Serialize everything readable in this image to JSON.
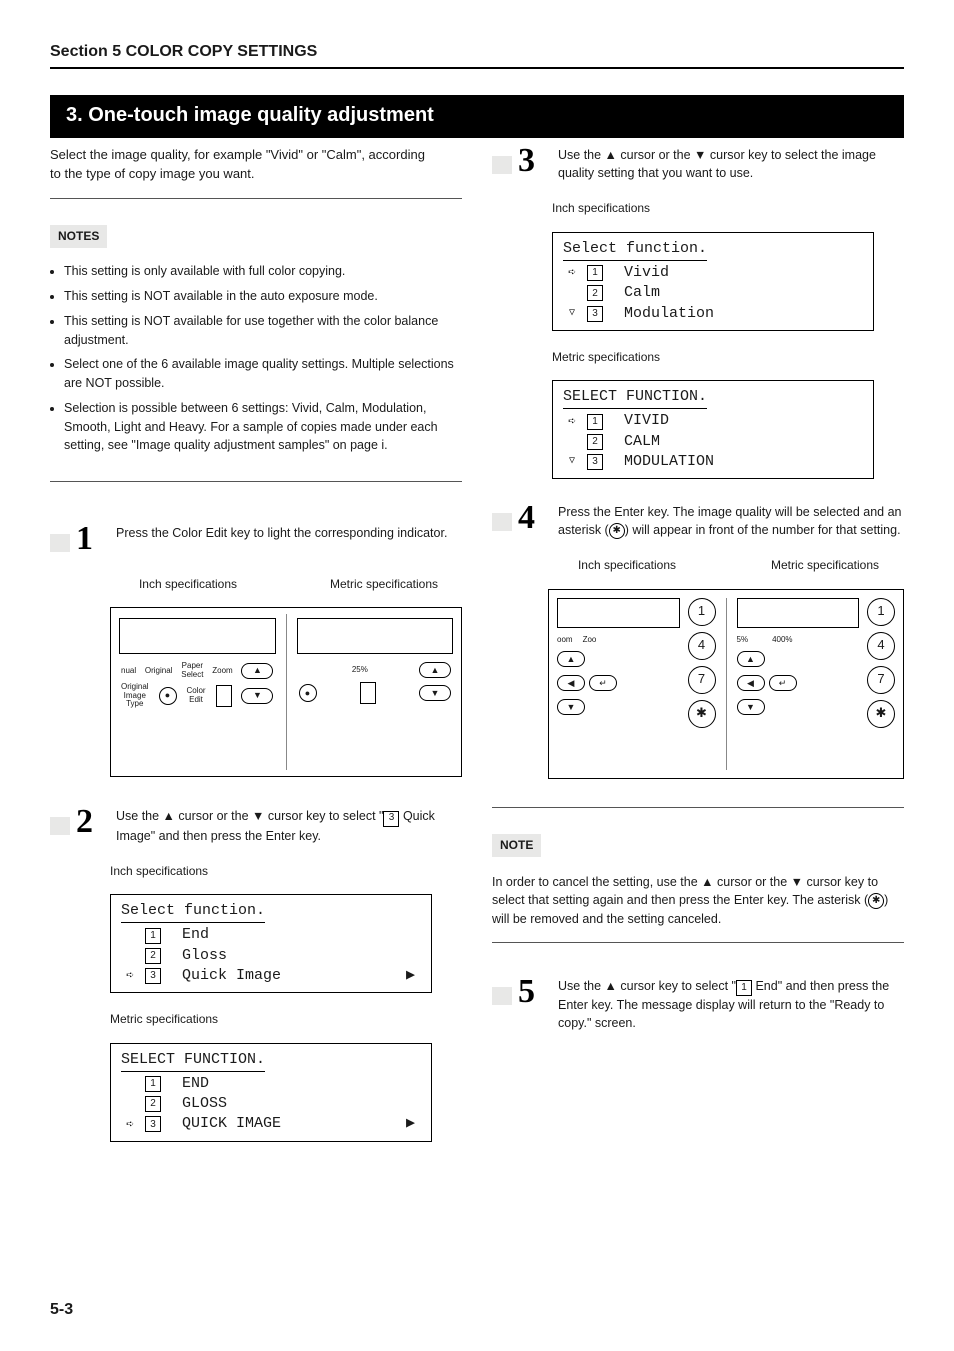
{
  "section_header": "Section 5  COLOR COPY SETTINGS",
  "title": "3.   One-touch image quality adjustment",
  "intro": "Select the image quality, for example \"Vivid\" or \"Calm\", according to the type of copy image you want.",
  "notes_heading": "NOTES",
  "notes": [
    "This setting is only available with full color copying.",
    "This setting is NOT available in the auto exposure mode.",
    "This setting is NOT available for use together with the color balance adjustment.",
    "Select one of the 6 available image quality settings. Multiple selections are NOT possible.",
    "Selection is possible between 6 settings: Vivid, Calm, Modulation, Smooth, Light and Heavy. For a sample of copies made under each setting, see \"Image quality adjustment samples\" on page i."
  ],
  "labels": {
    "inch": "Inch specifications",
    "metric": "Metric specifications"
  },
  "steps": {
    "s1": {
      "num": "1",
      "text": "Press the Color Edit key to light the corresponding indicator."
    },
    "s2": {
      "num": "2",
      "text_a": "Use the ▲ cursor or the ▼ cursor key to select \"",
      "text_b": " Quick Image\" and then press the Enter key."
    },
    "s3": {
      "num": "3",
      "text": "Use the ▲ cursor or the ▼ cursor key to select the image quality setting that you want to use."
    },
    "s4": {
      "num": "4",
      "text_a": "Press the Enter key. The image quality will be selected and an asterisk (",
      "text_b": ") will appear in front of the number for that setting."
    },
    "s5": {
      "num": "5",
      "text_a": "Use the ▲ cursor key to select \"",
      "text_b": " End\" and then press the Enter key. The message display will return to the \"Ready to copy.\" screen."
    }
  },
  "lcd": {
    "select_inch_title": "Select function.",
    "select_metric_title": "SELECT FUNCTION.",
    "menu1_inch": {
      "i1": "End",
      "i2": "Gloss",
      "i3": "Quick Image"
    },
    "menu1_metric": {
      "i1": "END",
      "i2": "GLOSS",
      "i3": "QUICK IMAGE"
    },
    "menu2_inch": {
      "i1": "Vivid",
      "i2": "Calm",
      "i3": "Modulation"
    },
    "menu2_metric": {
      "i1": "VIVID",
      "i2": "CALM",
      "i3": "MODULATION"
    }
  },
  "note2_heading": "NOTE",
  "note2_body_a": "In order to cancel the setting, use the ▲ cursor or the ▼ cursor key to select that setting again and then press the Enter key. The asterisk (",
  "note2_body_b": ") will be removed and the setting canceled.",
  "panel_labels": {
    "nual": "nual",
    "original": "Original",
    "paper_select": "Paper\nSelect",
    "zoom": "Zoom",
    "original_image_type": "Original\nImage\nType",
    "color_edit": "Color\nEdit",
    "pct25": "25%",
    "pct400": "400%",
    "boom": "oom",
    "zoo": "Zoo"
  },
  "keypad": {
    "k1": "1",
    "k4": "4",
    "k7": "7",
    "star": "✱",
    "enter": "↵"
  },
  "page_number": "5-3"
}
